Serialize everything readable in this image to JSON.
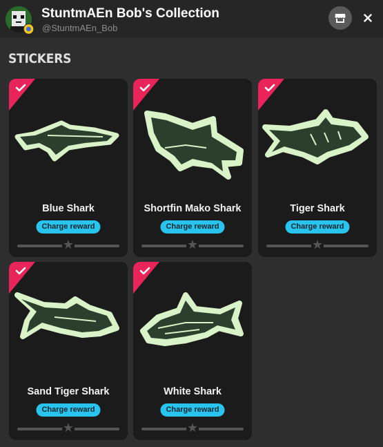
{
  "header": {
    "title": "StuntmAEn Bob's Collection",
    "handle": "@StuntmAEn_Bob"
  },
  "section": {
    "title": "STICKERS"
  },
  "colors": {
    "background": "#2e2e2e",
    "header_bg": "#262626",
    "card_bg": "#1b1b1b",
    "ribbon": "#e8245a",
    "reward_button": "#29c4ee",
    "sticker_tint": "#d9f2c8"
  },
  "cards": [
    {
      "name": "Blue Shark",
      "reward_label": "Charge reward",
      "rating": 0,
      "collected": true,
      "icon": "checkmark-icon"
    },
    {
      "name": "Shortfin Mako Shark",
      "reward_label": "Charge reward",
      "rating": 0,
      "collected": true,
      "icon": "checkmark-icon"
    },
    {
      "name": "Tiger Shark",
      "reward_label": "Charge reward",
      "rating": 0,
      "collected": true,
      "icon": "checkmark-icon"
    },
    {
      "name": "Sand Tiger Shark",
      "reward_label": "Charge reward",
      "rating": 0,
      "collected": true,
      "icon": "checkmark-icon"
    },
    {
      "name": "White Shark",
      "reward_label": "Charge reward",
      "rating": 0,
      "collected": true,
      "icon": "checkmark-icon"
    }
  ]
}
